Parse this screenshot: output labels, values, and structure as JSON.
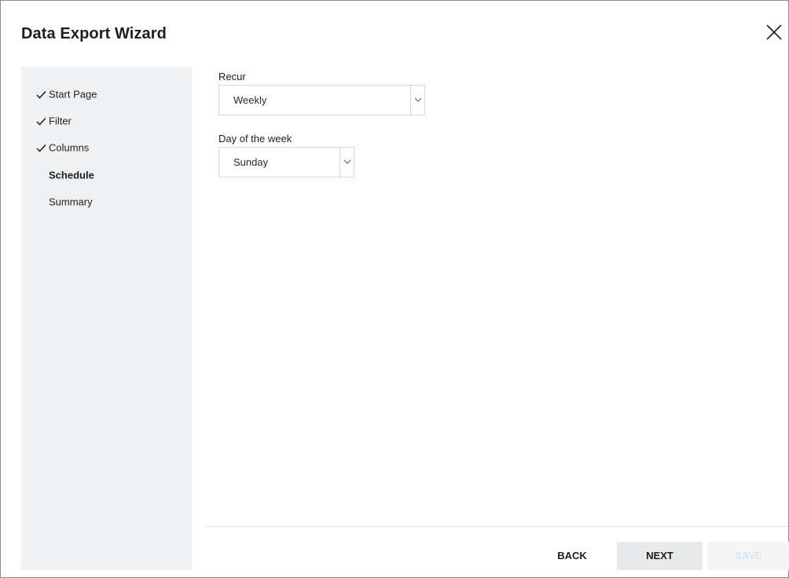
{
  "dialog": {
    "title": "Data Export Wizard",
    "close_icon": "close-icon"
  },
  "steps": [
    {
      "label": "Start Page",
      "state": "completed",
      "icon": "check-icon"
    },
    {
      "label": "Filter",
      "state": "completed",
      "icon": "check-icon"
    },
    {
      "label": "Columns",
      "state": "completed",
      "icon": "check-icon"
    },
    {
      "label": "Schedule",
      "state": "current",
      "icon": ""
    },
    {
      "label": "Summary",
      "state": "pending",
      "icon": ""
    }
  ],
  "form": {
    "recur": {
      "label": "Recur",
      "value": "Weekly",
      "icon": "chevron-down-icon"
    },
    "day_of_week": {
      "label": "Day of the week",
      "value": "Sunday",
      "icon": "chevron-down-icon"
    }
  },
  "buttons": {
    "back": "BACK",
    "next": "NEXT",
    "save": "SAVE",
    "save_disabled": true
  },
  "colors": {
    "sidebar_bg": "#f0f1f2",
    "next_bg": "#e8e9ea",
    "save_disabled_text": "#d4e6f3",
    "border": "#d6d6d6"
  }
}
